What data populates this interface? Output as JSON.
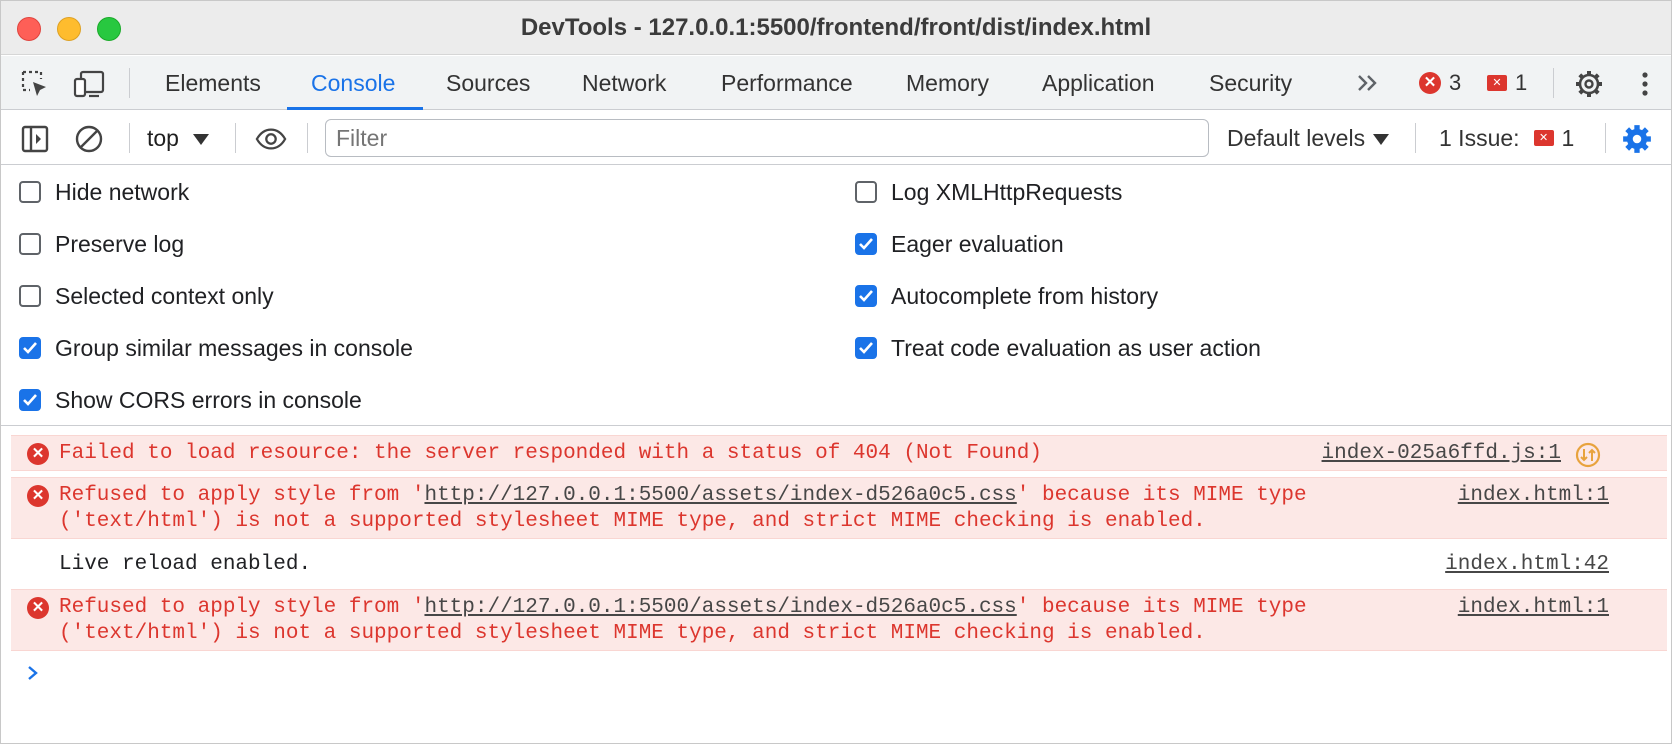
{
  "window": {
    "title": "DevTools - 127.0.0.1:5500/frontend/front/dist/index.html"
  },
  "tabs": {
    "items": [
      {
        "label": "Elements"
      },
      {
        "label": "Console"
      },
      {
        "label": "Sources"
      },
      {
        "label": "Network"
      },
      {
        "label": "Performance"
      },
      {
        "label": "Memory"
      },
      {
        "label": "Application"
      },
      {
        "label": "Security"
      }
    ],
    "active": "Console",
    "error_count": "3",
    "issue_count": "1"
  },
  "toolbar": {
    "context": "top",
    "filter_placeholder": "Filter",
    "levels": "Default levels",
    "issues_label": "1 Issue:",
    "issues_count": "1"
  },
  "settings": {
    "left": [
      {
        "label": "Hide network",
        "checked": false
      },
      {
        "label": "Preserve log",
        "checked": false
      },
      {
        "label": "Selected context only",
        "checked": false
      },
      {
        "label": "Group similar messages in console",
        "checked": true
      },
      {
        "label": "Show CORS errors in console",
        "checked": true
      }
    ],
    "right": [
      {
        "label": "Log XMLHttpRequests",
        "checked": false
      },
      {
        "label": "Eager evaluation",
        "checked": true
      },
      {
        "label": "Autocomplete from history",
        "checked": true
      },
      {
        "label": "Treat code evaluation as user action",
        "checked": true
      }
    ]
  },
  "messages": [
    {
      "level": "error",
      "text": "Failed to load resource: the server responded with a status of 404 (Not Found)",
      "source": "index-025a6ffd.js:1"
    },
    {
      "level": "error",
      "pre": "Refused to apply style from '",
      "url": "http://127.0.0.1:5500/assets/index-d526a0c5.css",
      "post": "' because its MIME type",
      "line2": "('text/html') is not a supported stylesheet MIME type, and strict MIME checking is enabled.",
      "source": "index.html:1"
    },
    {
      "level": "info",
      "text": "Live reload enabled.",
      "source": "index.html:42"
    },
    {
      "level": "error",
      "pre": "Refused to apply style from '",
      "url": "http://127.0.0.1:5500/assets/index-d526a0c5.css",
      "post": "' because its MIME type",
      "line2": "('text/html') is not a supported stylesheet MIME type, and strict MIME checking is enabled.",
      "source": "index.html:1"
    }
  ],
  "icons": {
    "inspect": "inspect-element-icon",
    "device": "device-toolbar-icon",
    "sidebar": "sidebar-toggle-icon",
    "clear": "clear-console-icon",
    "eye": "live-expression-icon",
    "settings": "gear-icon",
    "more": "kebab-menu-icon"
  },
  "colors": {
    "accent": "#1a73e8",
    "error": "#dc362e",
    "error_bg": "#fce8e6"
  }
}
